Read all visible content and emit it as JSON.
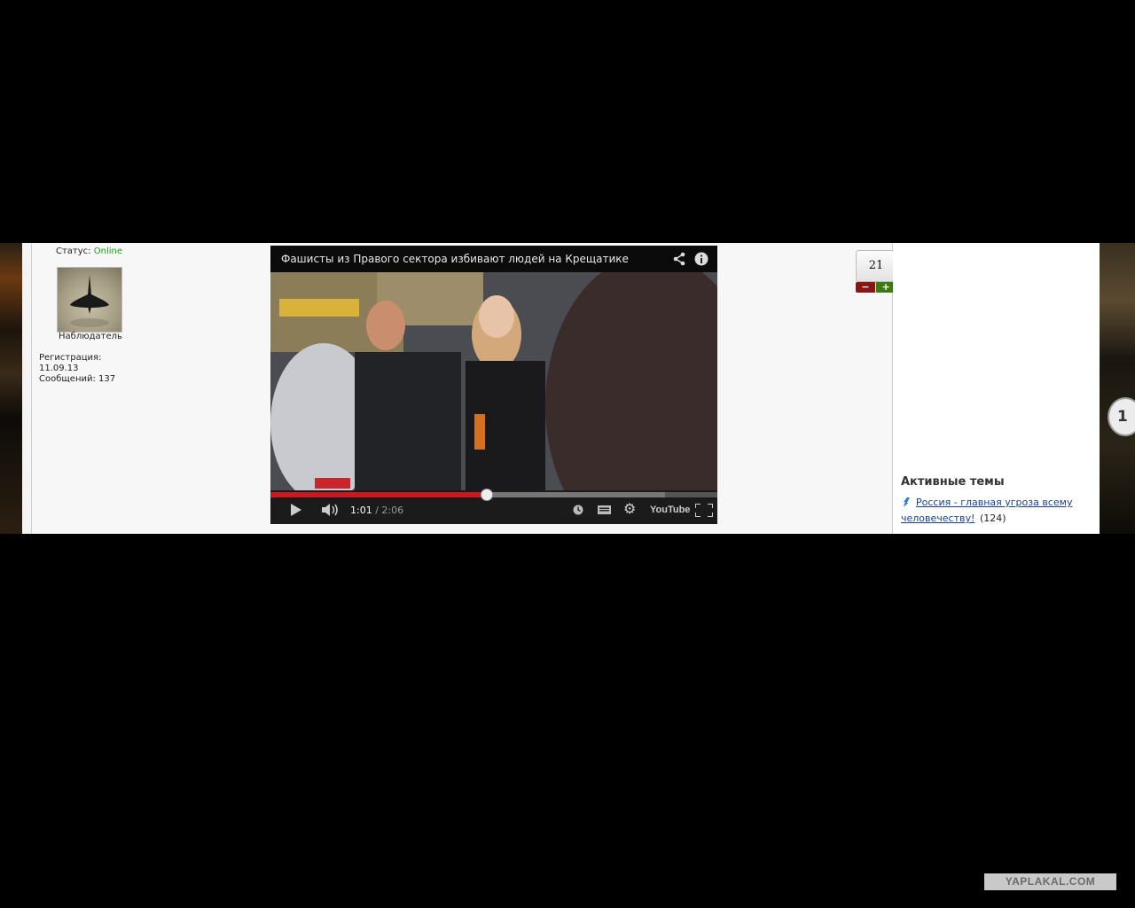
{
  "user": {
    "status_label": "Статус:",
    "status_value": "Online",
    "rank": "Наблюдатель",
    "reg_label": "Регистрация:",
    "reg_date": "11.09.13",
    "posts": "Сообщений: 137"
  },
  "video": {
    "title": "Фашисты из Правого сектора  избивают людей на Крещатике",
    "time_current": "1:01",
    "time_separator": " / ",
    "time_total": "2:06",
    "progress_fraction": 0.485,
    "icons": [
      "share-icon",
      "info-icon",
      "play-icon",
      "volume-icon",
      "watch-later-icon",
      "captions-icon",
      "settings-icon",
      "youtube-logo",
      "fullscreen-icon"
    ],
    "youtube_label": "YouTube"
  },
  "vote": {
    "score": "21",
    "minus": "−",
    "plus": "+"
  },
  "sidebar": {
    "heading": "Активные темы",
    "topics": [
      {
        "title_line1": "Россия - главная угроза всему",
        "title_line2": "человечеству!",
        "count": "(124)"
      }
    ]
  },
  "page_badge": "1",
  "watermark": "YAPLAKAL.COM",
  "colors": {
    "online": "#1f9d1f",
    "progress": "#cc181e",
    "vote_minus": "#8b1414",
    "vote_plus": "#3e7a14",
    "link": "#1b3f8f"
  }
}
